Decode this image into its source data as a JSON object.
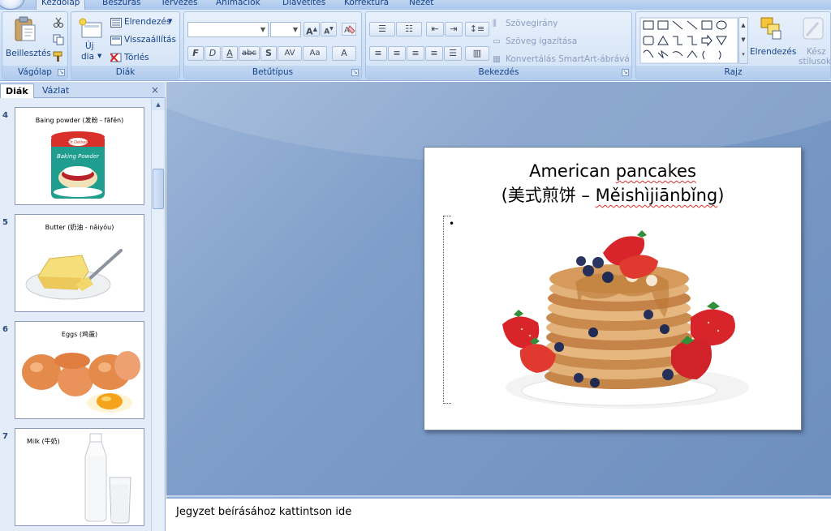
{
  "tabs": [
    {
      "label": "Kezdőlap",
      "active": true
    },
    {
      "label": "Beszúrás",
      "active": false
    },
    {
      "label": "Tervezés",
      "active": false
    },
    {
      "label": "Animációk",
      "active": false
    },
    {
      "label": "Diavetítés",
      "active": false
    },
    {
      "label": "Korrektúra",
      "active": false
    },
    {
      "label": "Nézet",
      "active": false
    }
  ],
  "ribbon": {
    "clipboard": {
      "label": "Vágólap",
      "paste": "Beillesztés"
    },
    "slides": {
      "label": "Diák",
      "new_slide_line1": "Új",
      "new_slide_line2": "dia",
      "layout": "Elrendezés",
      "reset": "Visszaállítás",
      "delete": "Törlés"
    },
    "font": {
      "label": "Betűtípus",
      "buttons": [
        "F",
        "D",
        "A",
        "abc",
        "S",
        "AV",
        "Aa",
        "A"
      ]
    },
    "paragraph": {
      "label": "Bekezdés",
      "text_direction": "Szövegirány",
      "align_text": "Szöveg igazítása",
      "convert_smartart": "Konvertálás SmartArt-ábrává"
    },
    "drawing": {
      "label": "Rajz",
      "arrange": "Elrendezés",
      "quick_styles_line1": "Kész",
      "quick_styles_line2": "stílusok"
    }
  },
  "panel": {
    "tab_slides": "Diák",
    "tab_outline": "Vázlat",
    "close": "×"
  },
  "thumbnails": [
    {
      "number": "4",
      "title": "Baing powder (发粉 - fāfěn)",
      "image": "baking-powder-can"
    },
    {
      "number": "5",
      "title": "Butter (奶油 - nǎiyóu)",
      "image": "butter-plate"
    },
    {
      "number": "6",
      "title": "Eggs (鸡蛋)",
      "image": "eggs"
    },
    {
      "number": "7",
      "title": "Milk (牛奶)",
      "image": "milk-bottle-glass"
    }
  ],
  "slide": {
    "title_line1_a": "American ",
    "title_line1_b": "pancakes",
    "title_line2_a": "(美式煎饼 – ",
    "title_line2_b": "Měishìjiānbǐng",
    "title_line2_c": ")",
    "bullet": "•",
    "image": "pancake-stack-with-berries",
    "can_label": "Baking Powder",
    "can_brand": "Dr.Oetker"
  },
  "notes": {
    "placeholder": "Jegyzet beírásához kattintson ide"
  },
  "colors": {
    "ribbon_bg": "#cddff5",
    "ribbon_text": "#15428b",
    "workspace": "#7f9ec9",
    "spellcheck": "#e0302c"
  }
}
